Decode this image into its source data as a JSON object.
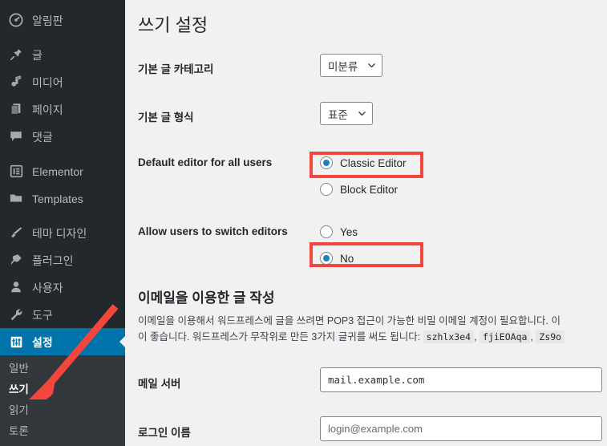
{
  "sidebar": {
    "items": [
      {
        "label": "알림판",
        "icon": "dashboard-icon",
        "active": false
      },
      {
        "label": "글",
        "icon": "pin-icon",
        "active": false
      },
      {
        "label": "미디어",
        "icon": "media-icon",
        "active": false
      },
      {
        "label": "페이지",
        "icon": "pages-icon",
        "active": false
      },
      {
        "label": "댓글",
        "icon": "comments-icon",
        "active": false
      },
      {
        "label": "Elementor",
        "icon": "elementor-icon",
        "active": false
      },
      {
        "label": "Templates",
        "icon": "folder-icon",
        "active": false
      },
      {
        "label": "테마 디자인",
        "icon": "appearance-brush-icon",
        "active": false
      },
      {
        "label": "플러그인",
        "icon": "plugins-plug-icon",
        "active": false
      },
      {
        "label": "사용자",
        "icon": "users-icon",
        "active": false
      },
      {
        "label": "도구",
        "icon": "tools-wrench-icon",
        "active": false
      },
      {
        "label": "설정",
        "icon": "settings-sliders-icon",
        "active": true
      }
    ],
    "submenu": [
      {
        "label": "일반",
        "current": false
      },
      {
        "label": "쓰기",
        "current": true
      },
      {
        "label": "읽기",
        "current": false
      },
      {
        "label": "토론",
        "current": false
      }
    ]
  },
  "page": {
    "title": "쓰기 설정"
  },
  "fields": {
    "default_category": {
      "label": "기본 글 카테고리",
      "value": "미분류"
    },
    "default_post_format": {
      "label": "기본 글 형식",
      "value": "표준"
    },
    "default_editor": {
      "label": "Default editor for all users",
      "options": [
        {
          "label": "Classic Editor",
          "checked": true
        },
        {
          "label": "Block Editor",
          "checked": false
        }
      ]
    },
    "allow_switch": {
      "label": "Allow users to switch editors",
      "options": [
        {
          "label": "Yes",
          "checked": false
        },
        {
          "label": "No",
          "checked": true
        }
      ]
    },
    "mail_server": {
      "label": "메일 서버",
      "value": "mail.example.com"
    },
    "login_name": {
      "label": "로그인 이름",
      "value": "",
      "placeholder": "login@example.com"
    }
  },
  "email_section": {
    "heading": "이메일을 이용한 글 작성",
    "desc_part1": "이메일을 이용해서 워드프레스에 글을 쓰려면 POP3 접근이 가능한 비밀 이메일 계정이 필요합니다. 이",
    "desc_part2": "이 좋습니다. 워드프레스가 무작위로 만든 3가지 글귀를 써도 됩니다:",
    "codes": [
      "szhlx3e4",
      "fjiEOAqa",
      "Zs9o"
    ],
    "separator": ","
  },
  "annotations": {
    "highlight_color": "#f4463c",
    "arrow_color": "#f4463c",
    "boxes": [
      {
        "name": "classic-editor-highlight"
      },
      {
        "name": "no-option-highlight"
      }
    ]
  },
  "colors": {
    "sidebar_bg": "#23282d",
    "submenu_bg": "#32373c",
    "active_blue": "#0073aa",
    "content_bg": "#f1f1f1",
    "radio_blue": "#1f7fbf"
  }
}
